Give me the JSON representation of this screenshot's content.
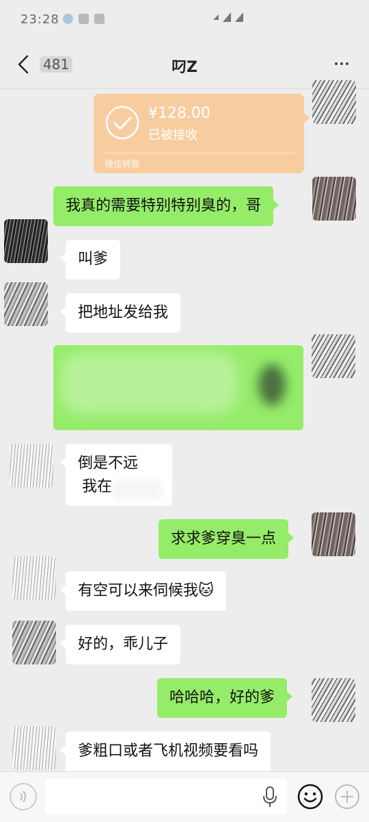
{
  "status_bar": {
    "time": "23:28"
  },
  "header": {
    "unread_count": "481",
    "title": "叼Z"
  },
  "transfer": {
    "amount": "¥128.00",
    "status": "已被接收",
    "label": "微信转账"
  },
  "messages": [
    {
      "side": "out",
      "text": "我真的需要特别特别臭的，哥"
    },
    {
      "side": "in",
      "text": "叫爹"
    },
    {
      "side": "in",
      "text": "把地址发给我"
    },
    {
      "side": "in",
      "line1": "倒是不远",
      "line2": "我在"
    },
    {
      "side": "out",
      "text": "求求爹穿臭一点"
    },
    {
      "side": "in",
      "text": "有空可以来伺候我🐱"
    },
    {
      "side": "in",
      "text": "好的，乖儿子"
    },
    {
      "side": "out",
      "text": "哈哈哈，好的爹"
    },
    {
      "side": "in",
      "text": "爹粗口或者飞机视频要看吗"
    }
  ],
  "input": {
    "placeholder": ""
  },
  "colors": {
    "outgoing": "#95ec69",
    "incoming": "#ffffff",
    "transfer": "#f7cda0",
    "background": "#ededed"
  }
}
